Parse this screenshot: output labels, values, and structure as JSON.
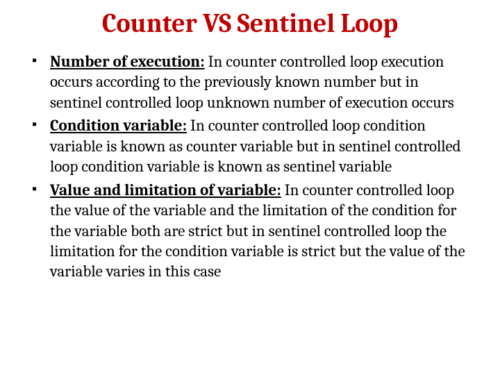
{
  "title": "Counter VS Sentinel Loop",
  "bullets": [
    {
      "lead": "Number of execution:",
      "rest": " In counter controlled loop execution occurs according to the previously known number but in sentinel controlled loop unknown number of execution occurs"
    },
    {
      "lead": "Condition variable:",
      "rest": " In counter controlled loop condition variable is known as counter variable but in sentinel controlled loop condition variable is known as sentinel variable"
    },
    {
      "lead": "Value and limitation of variable:",
      "rest": " In counter controlled loop the value of the variable and the limitation of the condition for the variable both are strict but in sentinel controlled loop the limitation for the condition variable is strict but the value of the variable varies in this case"
    }
  ]
}
